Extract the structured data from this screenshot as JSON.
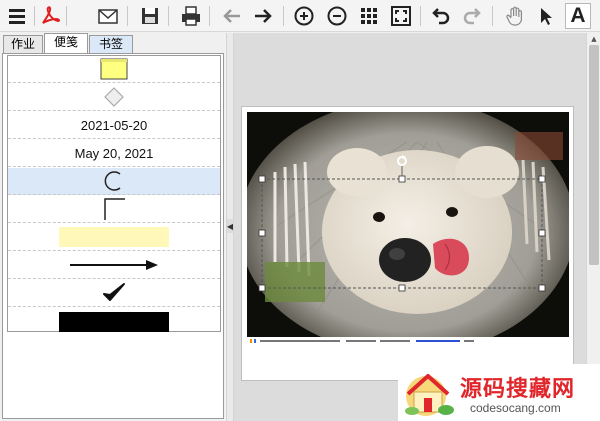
{
  "toolbar": {
    "buttons": [
      {
        "name": "menu",
        "icon": "menu-icon"
      },
      {
        "name": "pdf",
        "icon": "pdf-icon"
      },
      {
        "name": "email",
        "icon": "envelope-icon"
      },
      {
        "name": "save",
        "icon": "floppy-disk-icon"
      },
      {
        "name": "print",
        "icon": "printer-icon"
      },
      {
        "name": "back",
        "icon": "arrow-left-icon"
      },
      {
        "name": "forward",
        "icon": "arrow-right-icon"
      },
      {
        "name": "zoom-in",
        "icon": "zoom-in-icon"
      },
      {
        "name": "zoom-out",
        "icon": "zoom-out-icon"
      },
      {
        "name": "thumbnails",
        "icon": "grid-icon"
      },
      {
        "name": "fit-page",
        "icon": "fit-page-icon"
      },
      {
        "name": "undo",
        "icon": "undo-icon"
      },
      {
        "name": "redo",
        "icon": "redo-icon"
      },
      {
        "name": "pan",
        "icon": "hand-icon"
      },
      {
        "name": "select",
        "icon": "cursor-icon"
      },
      {
        "name": "text",
        "icon": "text-a-icon",
        "label": "A"
      }
    ]
  },
  "tabs": [
    {
      "label": "作业"
    },
    {
      "label": "便笺"
    },
    {
      "label": "书签"
    }
  ],
  "stamps": {
    "date_numeric": "2021-05-20",
    "date_long": "May 20, 2021",
    "items": [
      {
        "kind": "sticky-note",
        "color": "#ffff80"
      },
      {
        "kind": "diamond"
      },
      {
        "kind": "text-date-numeric"
      },
      {
        "kind": "text-date-long"
      },
      {
        "kind": "arc"
      },
      {
        "kind": "bracket"
      },
      {
        "kind": "highlight",
        "color": "#fff8b8"
      },
      {
        "kind": "arrow"
      },
      {
        "kind": "checkmark"
      },
      {
        "kind": "redaction-box",
        "color": "#000000"
      }
    ]
  },
  "watermark": {
    "title": "源码搜藏网",
    "url": "codesocang.com"
  },
  "colors": {
    "selected_row": "#dbe8f7",
    "pdf_red": "#e02020"
  }
}
